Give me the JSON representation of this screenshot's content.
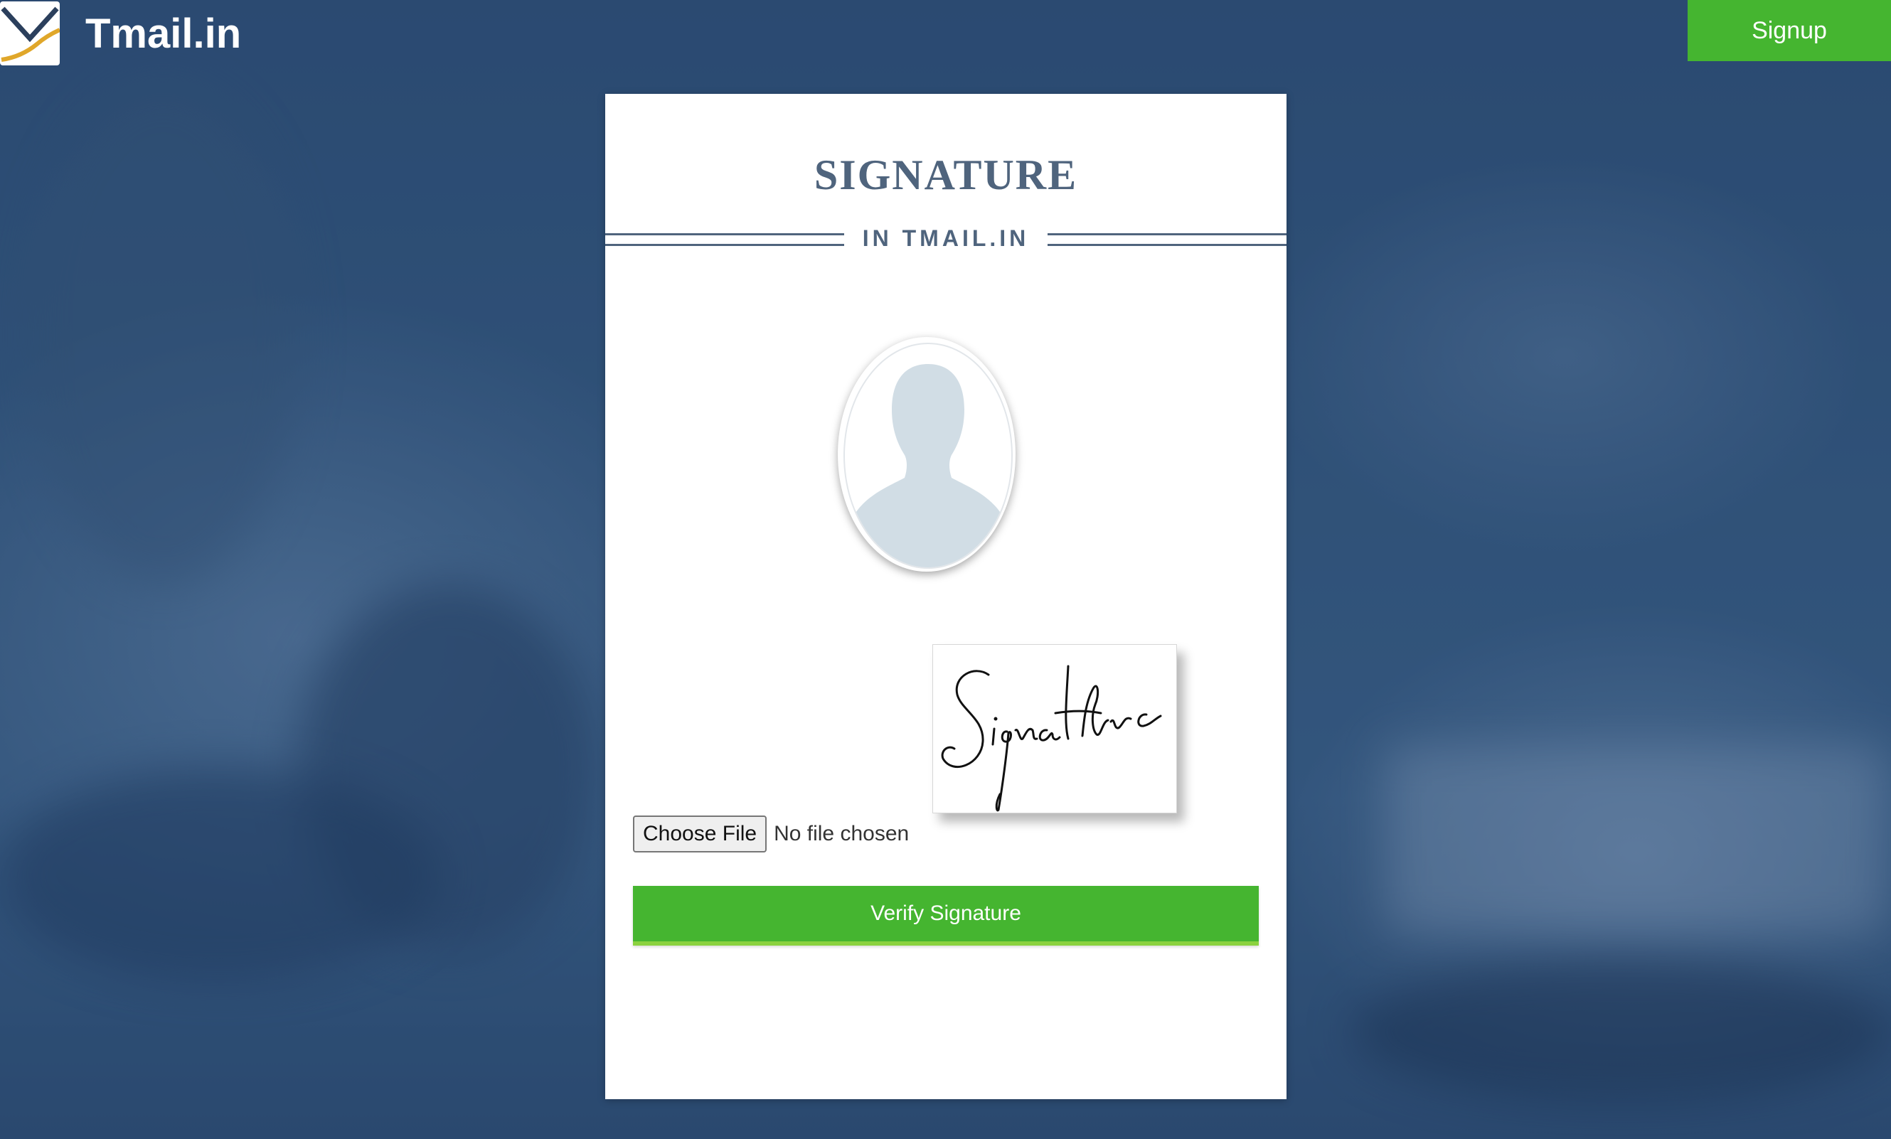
{
  "header": {
    "brand_name": "Tmail.in",
    "signup_label": "Signup"
  },
  "card": {
    "title": "SIGNATURE",
    "subtitle": "IN TMAIL.IN",
    "signature_sample_text": "Signature",
    "file_input": {
      "button_label": "Choose File",
      "status_text": "No file chosen"
    },
    "verify_label": "Verify Signature"
  },
  "colors": {
    "accent_green": "#45b530",
    "title_slate": "#4f647d",
    "background_blue": "#2f5178"
  },
  "icons": {
    "logo": "envelope-icon",
    "avatar": "user-silhouette-icon"
  }
}
